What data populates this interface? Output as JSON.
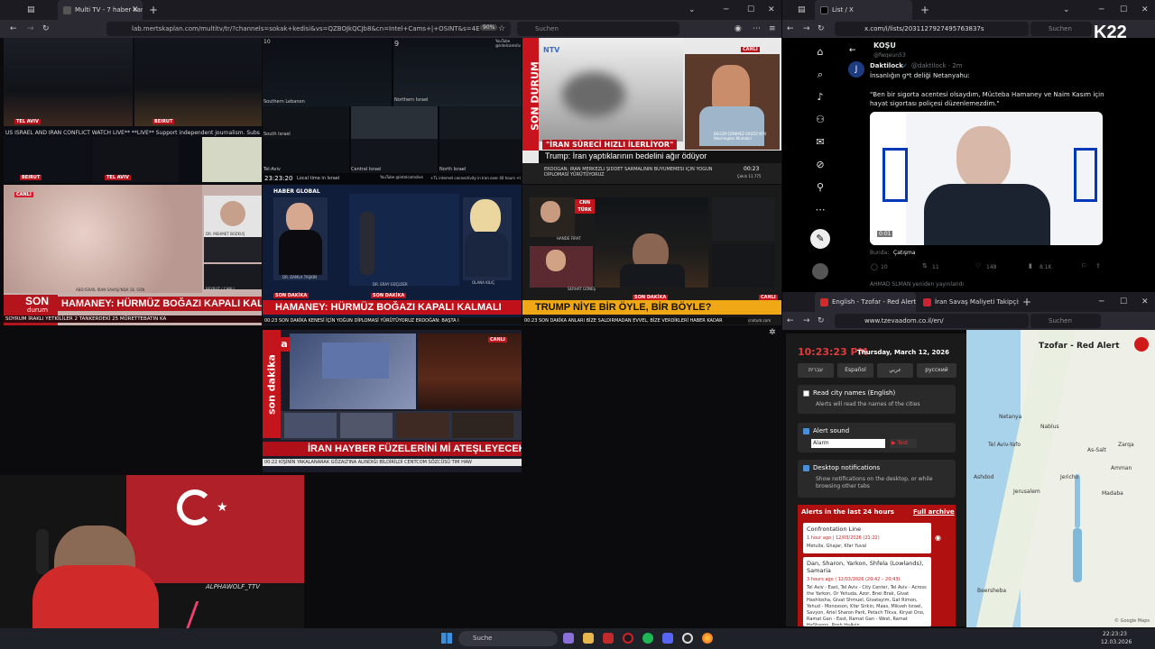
{
  "left_browser": {
    "tab_label": "Multi TV - 7 haber kanalı",
    "url": "lab.mertskaplan.com/multitv/tr/?channels=sokak+kedisi&vs=QZBOJkQCJb8&cn=Intel+Cams+|+OSINT&s=4E",
    "zoom": "90%",
    "search_placeholder": "Suchen",
    "tiles": {
      "t1": {
        "label_tel_aviv": "TEL AVIV",
        "label_beirut": "BEIRUT",
        "watch_text": "US ISRAEL AND IRAN CONFLICT WATCH LIVE**  **LIVE**  Support independent journalism. Subscribe to"
      },
      "t2": {
        "num_a": "10",
        "num_b": "9",
        "yt_label": "YouTube @intelcamslive",
        "northern": "Northern Israel",
        "southern": "Southern Lebanon",
        "south": "South Israel",
        "central": "Central Israel",
        "north": "North Israel",
        "telaviv": "Tel-Aviv",
        "time": "23:23:20",
        "local": "Local time in Israel",
        "yt2": "YouTube @intelcamslive",
        "footer": "+TL internet connectivity in Iran over 40 hours     +US-IRAN attack"
      },
      "t3": {
        "son_durum": "SON DURUM",
        "logo": "NTV",
        "canli": "CANLI",
        "banner": "\"İRAN SÜRECİ HIZLI İLERLİYOR\"",
        "headline": "Trump: İran yaptıklarının bedelini ağır ödüyor",
        "ticker": "ERDOĞAN: İRAN MERKEZLİ ŞİDDET SARMALININ BÜYÜMEMESİ İÇİN YOĞUN DİPLOMASİ YÜRÜTÜYORUZ",
        "time": "00:23",
        "ticker2": "Çekin 11.775",
        "name_tag": "BEGÜM DÖNMEZ ERSÖZ  NTV Washington Muhabiri"
      },
      "t4": {
        "canli": "CANLI",
        "name_tag": "DR. MEHMET BOZKUŞ",
        "place": "BEYRUT / CANLI",
        "son": "SON",
        "durum": "durum",
        "headline": "HAMANEY: HÜRMÜZ BOĞAZI KAPALI KALACAK",
        "ticker": "SOYRUM    İRAKLI YETKİLİLER 2 TANKERDEKİ 25 MÜRETTEBATIN KA",
        "caption": "ABD-İSRAİL İRAN SAVAŞI'NDA 18. GÜN"
      },
      "t5": {
        "logo": "HABER GLOBAL",
        "son_dakika": "SON DAKİKA",
        "headline": "HAMANEY: HÜRMÜZ BOĞAZI KAPALI KALMALI",
        "ticker": "00:23   SON DAKİKA  KENESİ İÇİN YOĞUN DİPLOMASİ YÜRÜTÜYORUZ     ERDOĞAN: BAŞTA I",
        "p1": "DR. DAMLA TAŞKIN",
        "p2": "DR. ERAY GÜÇLÜER",
        "p3": "OLANA KILIÇ"
      },
      "t6": {
        "logo": "CNN TÜRK",
        "canli": "CANLI",
        "headline": "TRUMP NİYE BİR ÖYLE, BİR BÖYLE?",
        "son_dakika": "SON DAKİKA",
        "ticker": "00:23  SON DAKİKA  ANLARI BİZE SALDIRMADAN EVVEL, BİZE VERDİKLERİ HABER KADAR",
        "site": "cnnturk.com",
        "p1": "HANDE FIRAT",
        "p2": "SERHAT GÜNEŞ",
        "p3": "FULYA ÖZTÜRK"
      },
      "t7": {
        "logo": "a",
        "canli": "CANLI",
        "side": "son dakika",
        "headline": "İRAN HAYBER FÜZELERİNİ Mİ ATEŞLEYECEK?",
        "ticker": "00:22  KİŞİNİN YAKALANARAK GÖZALTINA ALINDIĞI BİLDİRİLDİ     CENTCOM SÖZCÜSÜ TIM HAW",
        "time": "1.737,0"
      }
    }
  },
  "x_browser": {
    "tab_label": "List / X",
    "url": "x.com/i/lists/2031127927495763837s",
    "search_placeholder": "Suchen",
    "overlay": "K22",
    "list_title": "KOŞU",
    "handle": "@fwqeun53",
    "author": "Daktilock",
    "verified": "✓",
    "author_handle": "@daktilock · 2m",
    "post_line1": "İnsanlığın g*t deliği Netanyahu:",
    "post_quote": "\"Ben bir sigorta acentesi olsaydım, Mücteba Hamaney ve Naim Kasım için hayat sigortası poliçesi düzenlemezdim.\"",
    "video_time": "0:01",
    "source_prefix": "Bunda:",
    "source": "Çatışma",
    "stats": {
      "replies": "10",
      "reposts": "11",
      "likes": "148",
      "views": "8.1K"
    },
    "repost_note": "AHMAD SLMAN yeniden yayınlandı"
  },
  "tzofar_browser": {
    "tab1_label": "English - Tzofar - Red Alert",
    "tab2_label": "İran Savaş Maliyeti Takipçisi - A",
    "url": "www.tzevaadom.co.il/en/",
    "search_placeholder": "Suchen",
    "clock": "10:23:23 PM",
    "date": "Thursday, March 12, 2026",
    "languages": [
      "עברית",
      "Español",
      "عربي",
      "русский"
    ],
    "read_names": {
      "title": "Read city names (English)",
      "desc": "Alerts will read the names of the cities"
    },
    "alert_sound": {
      "title": "Alert sound",
      "value": "Alarm",
      "test": "▶ Test"
    },
    "desktop": {
      "title": "Desktop notifications",
      "desc": "Show notifications on the desktop, or while browsing other tabs"
    },
    "alerts_header": "Alerts in the last 24 hours",
    "archive": "Full archive",
    "alert1": {
      "title": "Confrontation Line",
      "time": "1 hour ago | 12/03/2026 (21:22)",
      "places": "Metulla, Ghajar, Kfar Yuval"
    },
    "alert2": {
      "title": "Dan, Sharon, Yarkon, Shfela (Lowlands), Samaria",
      "time": "3 hours ago | 12/03/2026 (20:42 – 20:43)",
      "places": "Tel Aviv - East, Tel Aviv - City Center, Tel Aviv - Across the Yarkon, Or Yehuda, Azor, Bnei Brak, Givat Hashlosha, Givat Shmuel, Givatayim, Gat Rimon, Yehud - Monosson, Kfar Sirkin, Maas, Mikveh Israel, Savyon, Ariel Sharon Park, Petach Tikva, Kiryat Ono, Ramat Gan - East, Ramat Gan - West, Ramat HaSharon, Rosh HaAyin"
    },
    "map": {
      "title": "Tzofar - Red Alert",
      "cities": [
        "Netanya",
        "Tel Aviv-Yafo",
        "Jerusalem",
        "Beersheba",
        "Ashdod",
        "Nablus",
        "Jericho",
        "Amman",
        "Zarqa",
        "As-Salt",
        "Madaba"
      ],
      "credit": "© Google Maps"
    }
  },
  "webcam": {
    "overlay": "ALPHAWOLF_TTV"
  },
  "taskbar": {
    "search": "Suche",
    "time": "22:23:23",
    "date": "12.03.2026"
  }
}
